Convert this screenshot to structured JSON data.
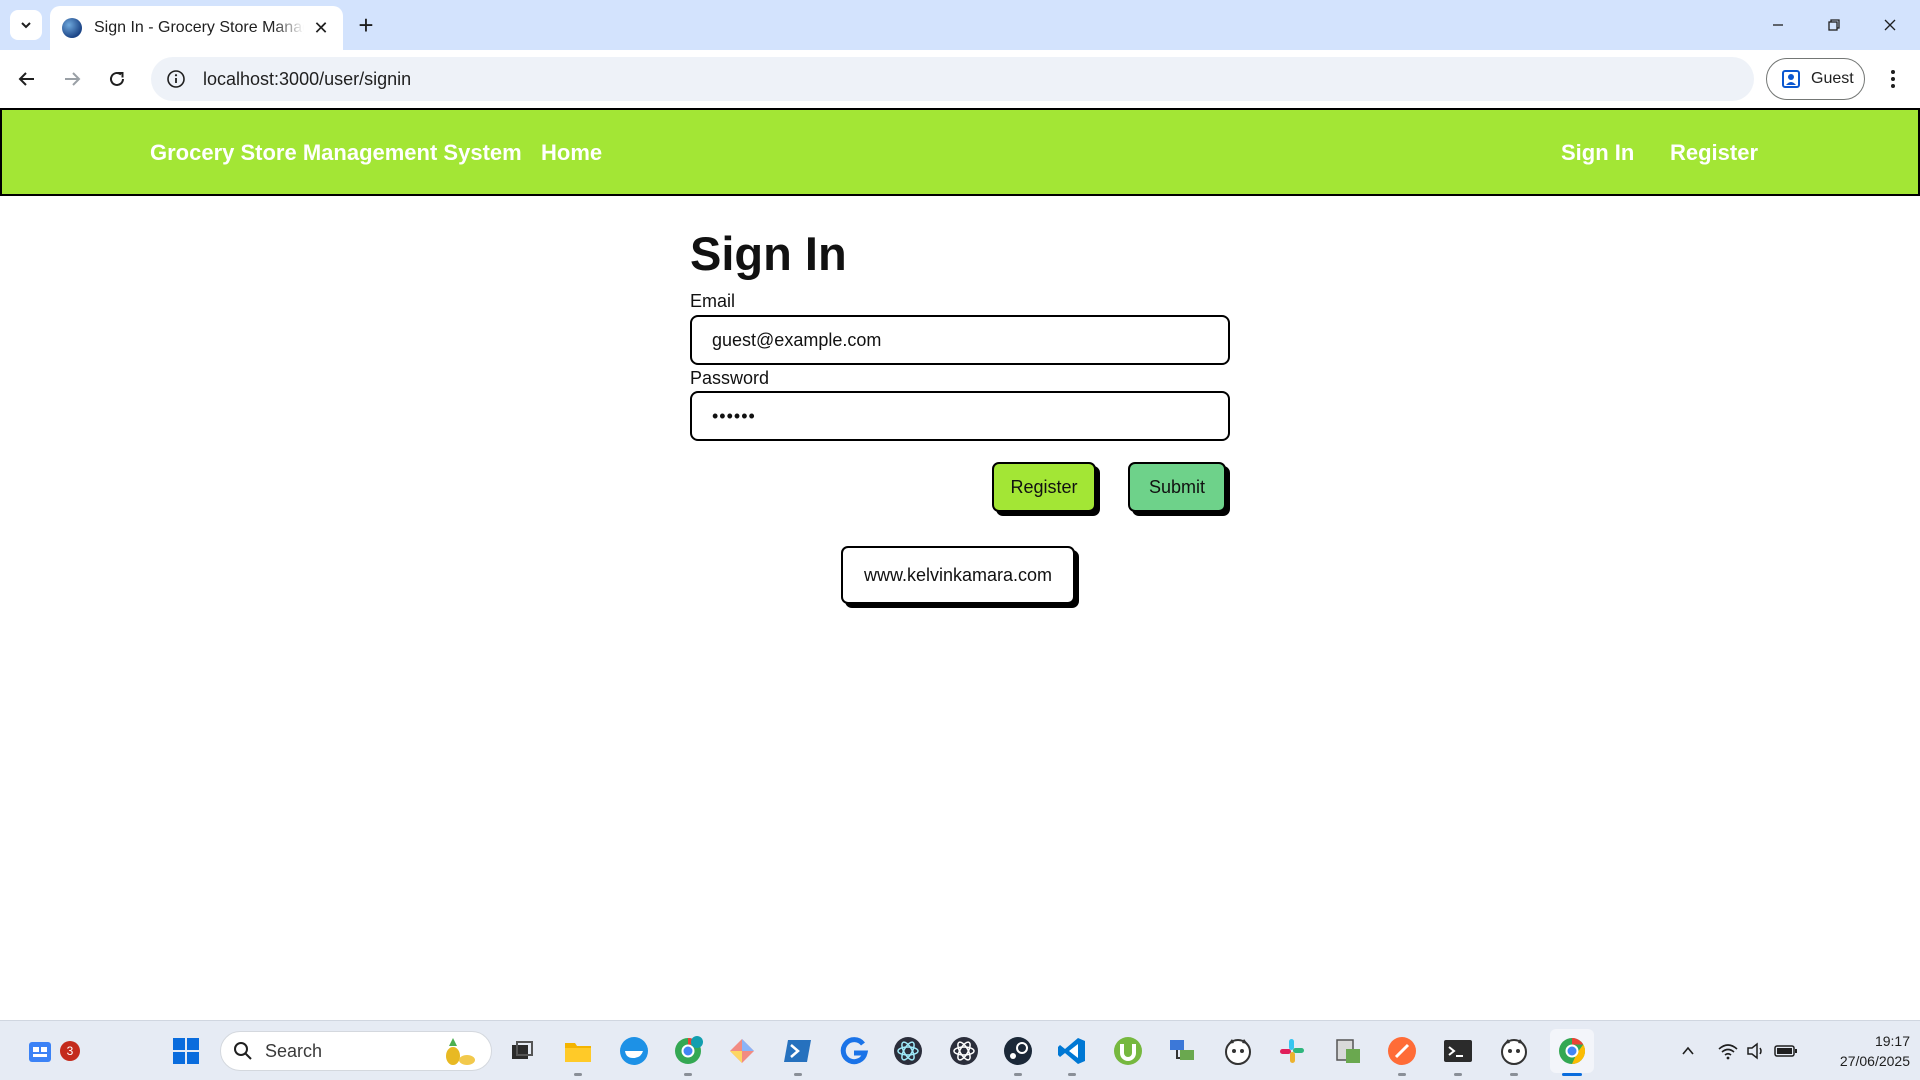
{
  "browser": {
    "tab_title": "Sign In - Grocery Store Management System",
    "url": "localhost:3000/user/signin",
    "profile_label": "Guest"
  },
  "nav": {
    "brand": "Grocery Store Management System",
    "home": "Home",
    "sign_in": "Sign In",
    "register": "Register",
    "background_color": "#a3e635"
  },
  "form": {
    "heading": "Sign In",
    "email_label": "Email",
    "email_value": "guest@example.com",
    "password_label": "Password",
    "password_value": "••••••",
    "register_button": "Register",
    "submit_button": "Submit",
    "register_button_color": "#a3e635",
    "submit_button_color": "#6ed28a"
  },
  "footer_link": "www.kelvinkamara.com",
  "taskbar": {
    "search_placeholder": "Search",
    "notification_count": "3",
    "time": "19:17",
    "date": "27/06/2025"
  }
}
